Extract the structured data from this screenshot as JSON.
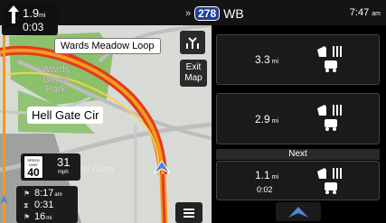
{
  "top_bar": {
    "turn_distance": "1.9",
    "turn_distance_unit": "mi",
    "turn_time": "0:03",
    "route_chevron": "»",
    "route_number": "278",
    "route_direction": "WB",
    "clock_time": "7:47",
    "clock_suffix": "am"
  },
  "map": {
    "callout_label": "Wards Meadow Loop",
    "street_label": "Hell Gate Cir",
    "park_label_line1": "Wards",
    "park_label_line2": "Island",
    "park_label_line3": "Park",
    "faded_label": "Hell Gate",
    "exit_button_line1": "Exit",
    "exit_button_line2": "Map"
  },
  "speed": {
    "limit_text_line1": "SPEED",
    "limit_text_line2": "LIMIT",
    "limit_value": "40",
    "current_value": "31",
    "current_unit": "mph"
  },
  "trip": {
    "eta": "8:17",
    "eta_suffix": "am",
    "remaining_time": "0:31",
    "remaining_distance": "16",
    "remaining_distance_unit": "mi"
  },
  "panel": {
    "poi_items": [
      {
        "distance": "3.3",
        "unit": "mi",
        "time": ""
      },
      {
        "distance": "2.9",
        "unit": "mi",
        "time": ""
      },
      {
        "distance": "1.1",
        "unit": "mi",
        "time": "0:02"
      }
    ],
    "next_label": "Next"
  },
  "colors": {
    "route_orange": "#f39a1f",
    "route_red": "#e33a1f",
    "park_green": "#8cc06b",
    "water_gray": "#9aa09b",
    "position_blue": "#4f85d8"
  }
}
